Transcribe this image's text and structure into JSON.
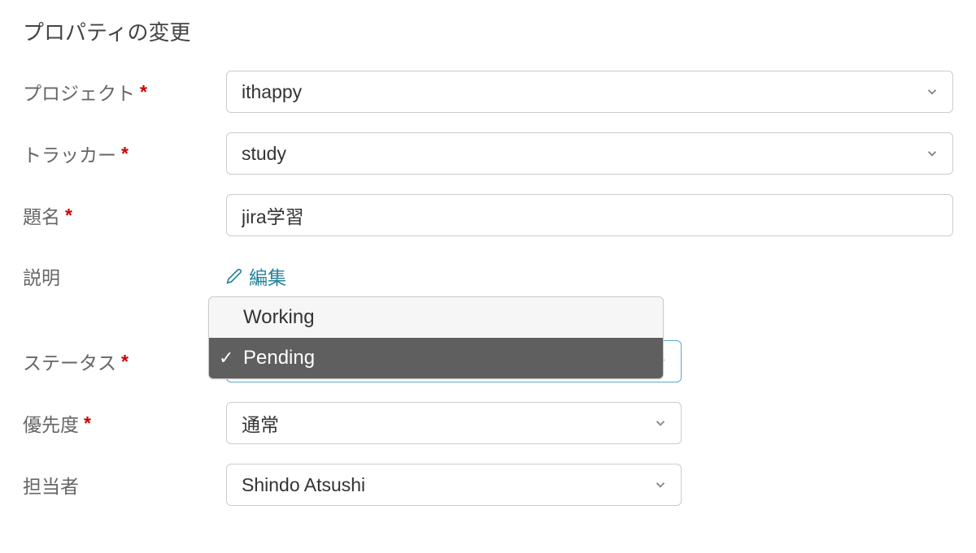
{
  "section_title": "プロパティの変更",
  "fields": {
    "project": {
      "label": "プロジェクト",
      "required": "*",
      "value": "ithappy"
    },
    "tracker": {
      "label": "トラッカー",
      "required": "*",
      "value": "study"
    },
    "subject": {
      "label": "題名",
      "required": "*",
      "value": "jira学習"
    },
    "description": {
      "label": "説明",
      "edit_text": "編集"
    },
    "status": {
      "label": "ステータス",
      "required": "*",
      "options": [
        {
          "label": "Working",
          "selected": false
        },
        {
          "label": "Pending",
          "selected": true
        }
      ]
    },
    "priority": {
      "label": "優先度",
      "required": "*",
      "value": "通常"
    },
    "assignee": {
      "label": "担当者",
      "value": "Shindo Atsushi"
    }
  }
}
